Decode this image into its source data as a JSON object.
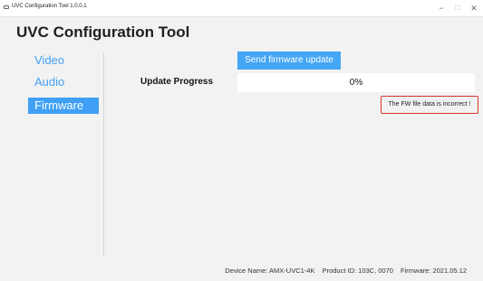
{
  "window": {
    "title": "UVC Configuration Tool 1.0.0.1",
    "controls": {
      "minimize": "−",
      "maximize": "□",
      "close": "✕"
    }
  },
  "app": {
    "title": "UVC Configuration Tool"
  },
  "nav": {
    "items": [
      {
        "label": "Video",
        "selected": false
      },
      {
        "label": "Audio",
        "selected": false
      },
      {
        "label": "Firmware",
        "selected": true
      }
    ]
  },
  "firmware": {
    "send_button": "Send firmware update",
    "progress_label": "Update Progress",
    "progress_text": "0%",
    "progress_fraction": 0,
    "error_message": "The FW file data is incorrect !"
  },
  "status": {
    "device_name": "Device Name: AMX-UVC1-4K",
    "product_id": "Product ID: 103C, 0070",
    "firmware": "Firmware: 2021.05.12"
  },
  "colors": {
    "accent": "#44a6f5",
    "nav_text": "#3fa0f5",
    "error_border": "#d9342b",
    "background": "#f2f2f2"
  }
}
